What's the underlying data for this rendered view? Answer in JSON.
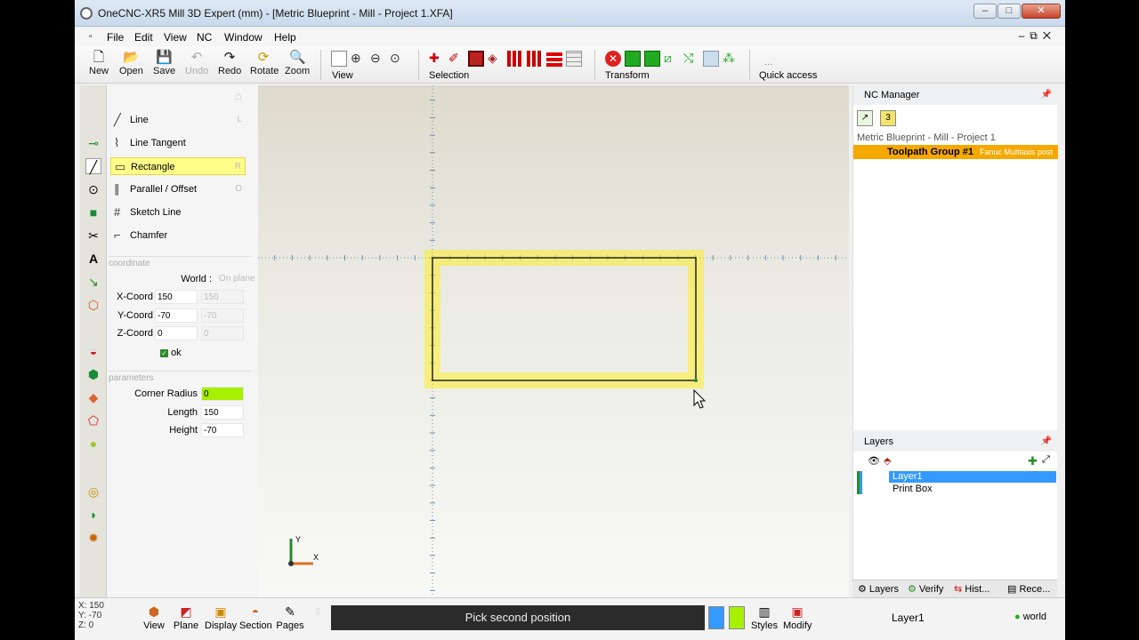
{
  "window": {
    "title": "OneCNC-XR5 Mill 3D Expert (mm) - [Metric Blueprint - Mill - Project 1.XFA]"
  },
  "menu": [
    "File",
    "Edit",
    "View",
    "NC",
    "Window",
    "Help"
  ],
  "toolbar": {
    "new": "New",
    "open": "Open",
    "save": "Save",
    "undo": "Undo",
    "redo": "Redo",
    "rotate": "Rotate",
    "zoom": "Zoom",
    "view": "View",
    "selection": "Selection",
    "transform": "Transform",
    "quick_access": "Quick access",
    "quick_dots": "..."
  },
  "commands": [
    {
      "label": "Line",
      "key": "L"
    },
    {
      "label": "Line Tangent",
      "key": ""
    },
    {
      "label": "Rectangle",
      "key": "R"
    },
    {
      "label": "Parallel / Offset",
      "key": "O"
    },
    {
      "label": "Sketch Line",
      "key": ""
    },
    {
      "label": "Chamfer",
      "key": ""
    }
  ],
  "coordinate": {
    "section": "coordinate",
    "world": "World :",
    "onplane": "On plane",
    "x_label": "X-Coord",
    "x_value": "150",
    "x_plane": "150",
    "y_label": "Y-Coord",
    "y_value": "-70",
    "y_plane": "-70",
    "z_label": "Z-Coord",
    "z_value": "0",
    "z_plane": "0",
    "ok": "ok"
  },
  "parameters": {
    "section": "parameters",
    "corner_label": "Corner Radius",
    "corner_value": "0",
    "length_label": "Length",
    "length_value": "150",
    "height_label": "Height",
    "height_value": "-70"
  },
  "axis": {
    "y": "Y",
    "x": "X"
  },
  "nc_manager": {
    "title": "NC Manager",
    "project": "Metric Blueprint - Mill - Project 1",
    "group": "Toolpath Group #1",
    "post": "Fanuc Multiaxis post",
    "badge": "3"
  },
  "layers": {
    "title": "Layers",
    "items": [
      "Layer1",
      "Print Box"
    ]
  },
  "panel_tabs": [
    "Layers",
    "Verify",
    "Hist...",
    "Rece..."
  ],
  "status": {
    "x": "X: 150",
    "y": "Y: -70",
    "z": "Z: 0",
    "buttons": [
      "View",
      "Plane",
      "Display",
      "Section",
      "Pages"
    ],
    "prompt": "Pick second position",
    "styles": "Styles",
    "modify": "Modify",
    "layer": "Layer1",
    "world": "world"
  },
  "colors": {
    "highlight": "#ffff8a",
    "accent_green": "#a6f000",
    "orange": "#f5a800",
    "selection_blue": "#3399ff"
  }
}
